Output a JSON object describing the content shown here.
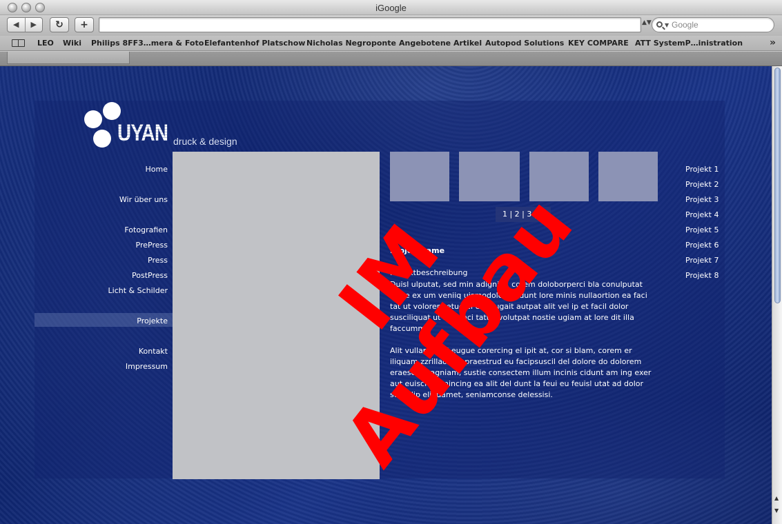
{
  "window": {
    "title": "iGoogle"
  },
  "toolbar": {
    "back_label": "◀",
    "forward_label": "▶",
    "reload_label": "↻",
    "add_label": "+",
    "url": "",
    "search_placeholder": "Google"
  },
  "bookmarks": {
    "items": [
      "LEO",
      "Wiki",
      "Philips 8FF3…mera & Foto",
      "Elefantenhof Platschow",
      "Nicholas Negroponte",
      "Angebotene Artikel",
      "Autopod Solutions",
      "KEY COMPARE",
      "ATT SystemP…inistration"
    ],
    "more_label": "»"
  },
  "site": {
    "logo_word": "UYAN",
    "logo_sub": "druck & design",
    "left_nav": [
      "Home",
      "Wir über uns",
      "Fotografien",
      "PrePress",
      "Press",
      "PostPress",
      "Licht & Schilder",
      "Projekte",
      "Kontakt",
      "Impressum"
    ],
    "active_nav": "Projekte",
    "pager": "1 | 2 | 3 | 4",
    "project_name": "Projektname",
    "project_description_title": "Projektbeschreibung",
    "paragraph1": "Duisl ulputat, sed min adigniat, corem doloborperci bla conulputat iriure ex um veniiq uismodolor acidunt lore minis nullaortion ea faci tat ut volorem etue el eu feugait autpat alit vel ip et facil dolor susciliquat ut ipiscinci tatue volutpat nostie ugiam at lore dit illa faccummy.",
    "paragraph2": "Alit vullamet, si eugue corercing el ipit at, cor si blam, corem er iliquam zzrillaoreet praestrud eu facipsuscil del dolore do dolorem eraesed magniam, sustie consectem illum incinis cidunt am ing exer aut euisci tie mincing ea alit del dunt la feui eu feuisl utat ad dolor sum dip eliquamet, seniamconse delessisi.",
    "right_nav": [
      "Projekt 1",
      "Projekt 2",
      "Projekt 3",
      "Projekt 4",
      "Projekt 5",
      "Projekt 6",
      "Projekt 7",
      "Projekt 8"
    ],
    "stamp_line1": "IM",
    "stamp_line2": "Aufbau"
  }
}
